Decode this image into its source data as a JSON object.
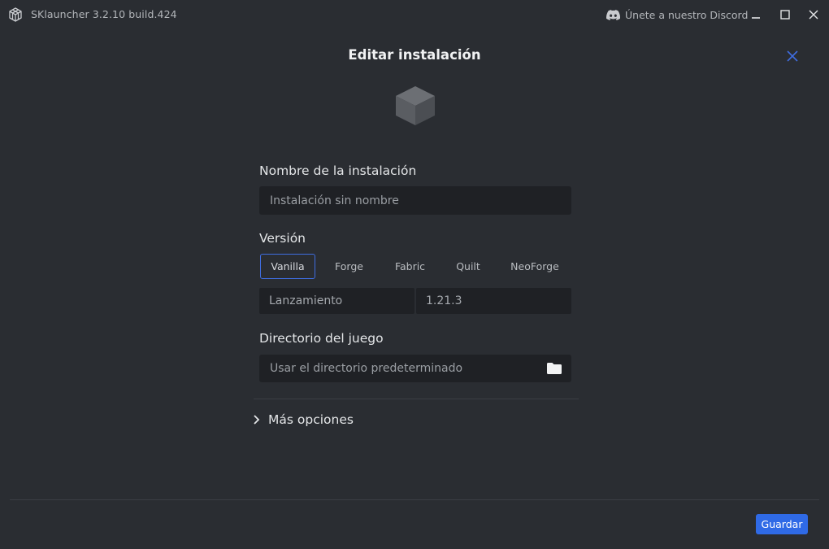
{
  "titlebar": {
    "app_title": "SKlauncher 3.2.10 build.424",
    "discord_label": "Únete a nuestro Discord",
    "icons": [
      "sklauncher-logo-icon",
      "discord-icon",
      "minimize-icon",
      "maximize-icon",
      "close-icon"
    ]
  },
  "dialog": {
    "title": "Editar instalación",
    "close_icon": "close-icon",
    "installation_icon": "cube-icon",
    "name": {
      "label": "Nombre de la instalación",
      "placeholder": "Instalación sin nombre",
      "value": ""
    },
    "version": {
      "label": "Versión",
      "tabs": [
        {
          "label": "Vanilla",
          "active": true
        },
        {
          "label": "Forge",
          "active": false
        },
        {
          "label": "Fabric",
          "active": false
        },
        {
          "label": "Quilt",
          "active": false
        },
        {
          "label": "NeoForge",
          "active": false
        }
      ],
      "type_value": "Lanzamiento",
      "version_value": "1.21.3"
    },
    "directory": {
      "label": "Directorio del juego",
      "placeholder": "Usar el directorio predeterminado",
      "folder_icon": "folder-icon"
    },
    "more_options_label": "Más opciones",
    "save_label": "Guardar"
  },
  "colors": {
    "background": "#2a2d32",
    "input_bg": "#1f2125",
    "accent": "#2f6ae6",
    "tab_active_border": "#3f6de0",
    "close_icon": "#3f6de0"
  }
}
